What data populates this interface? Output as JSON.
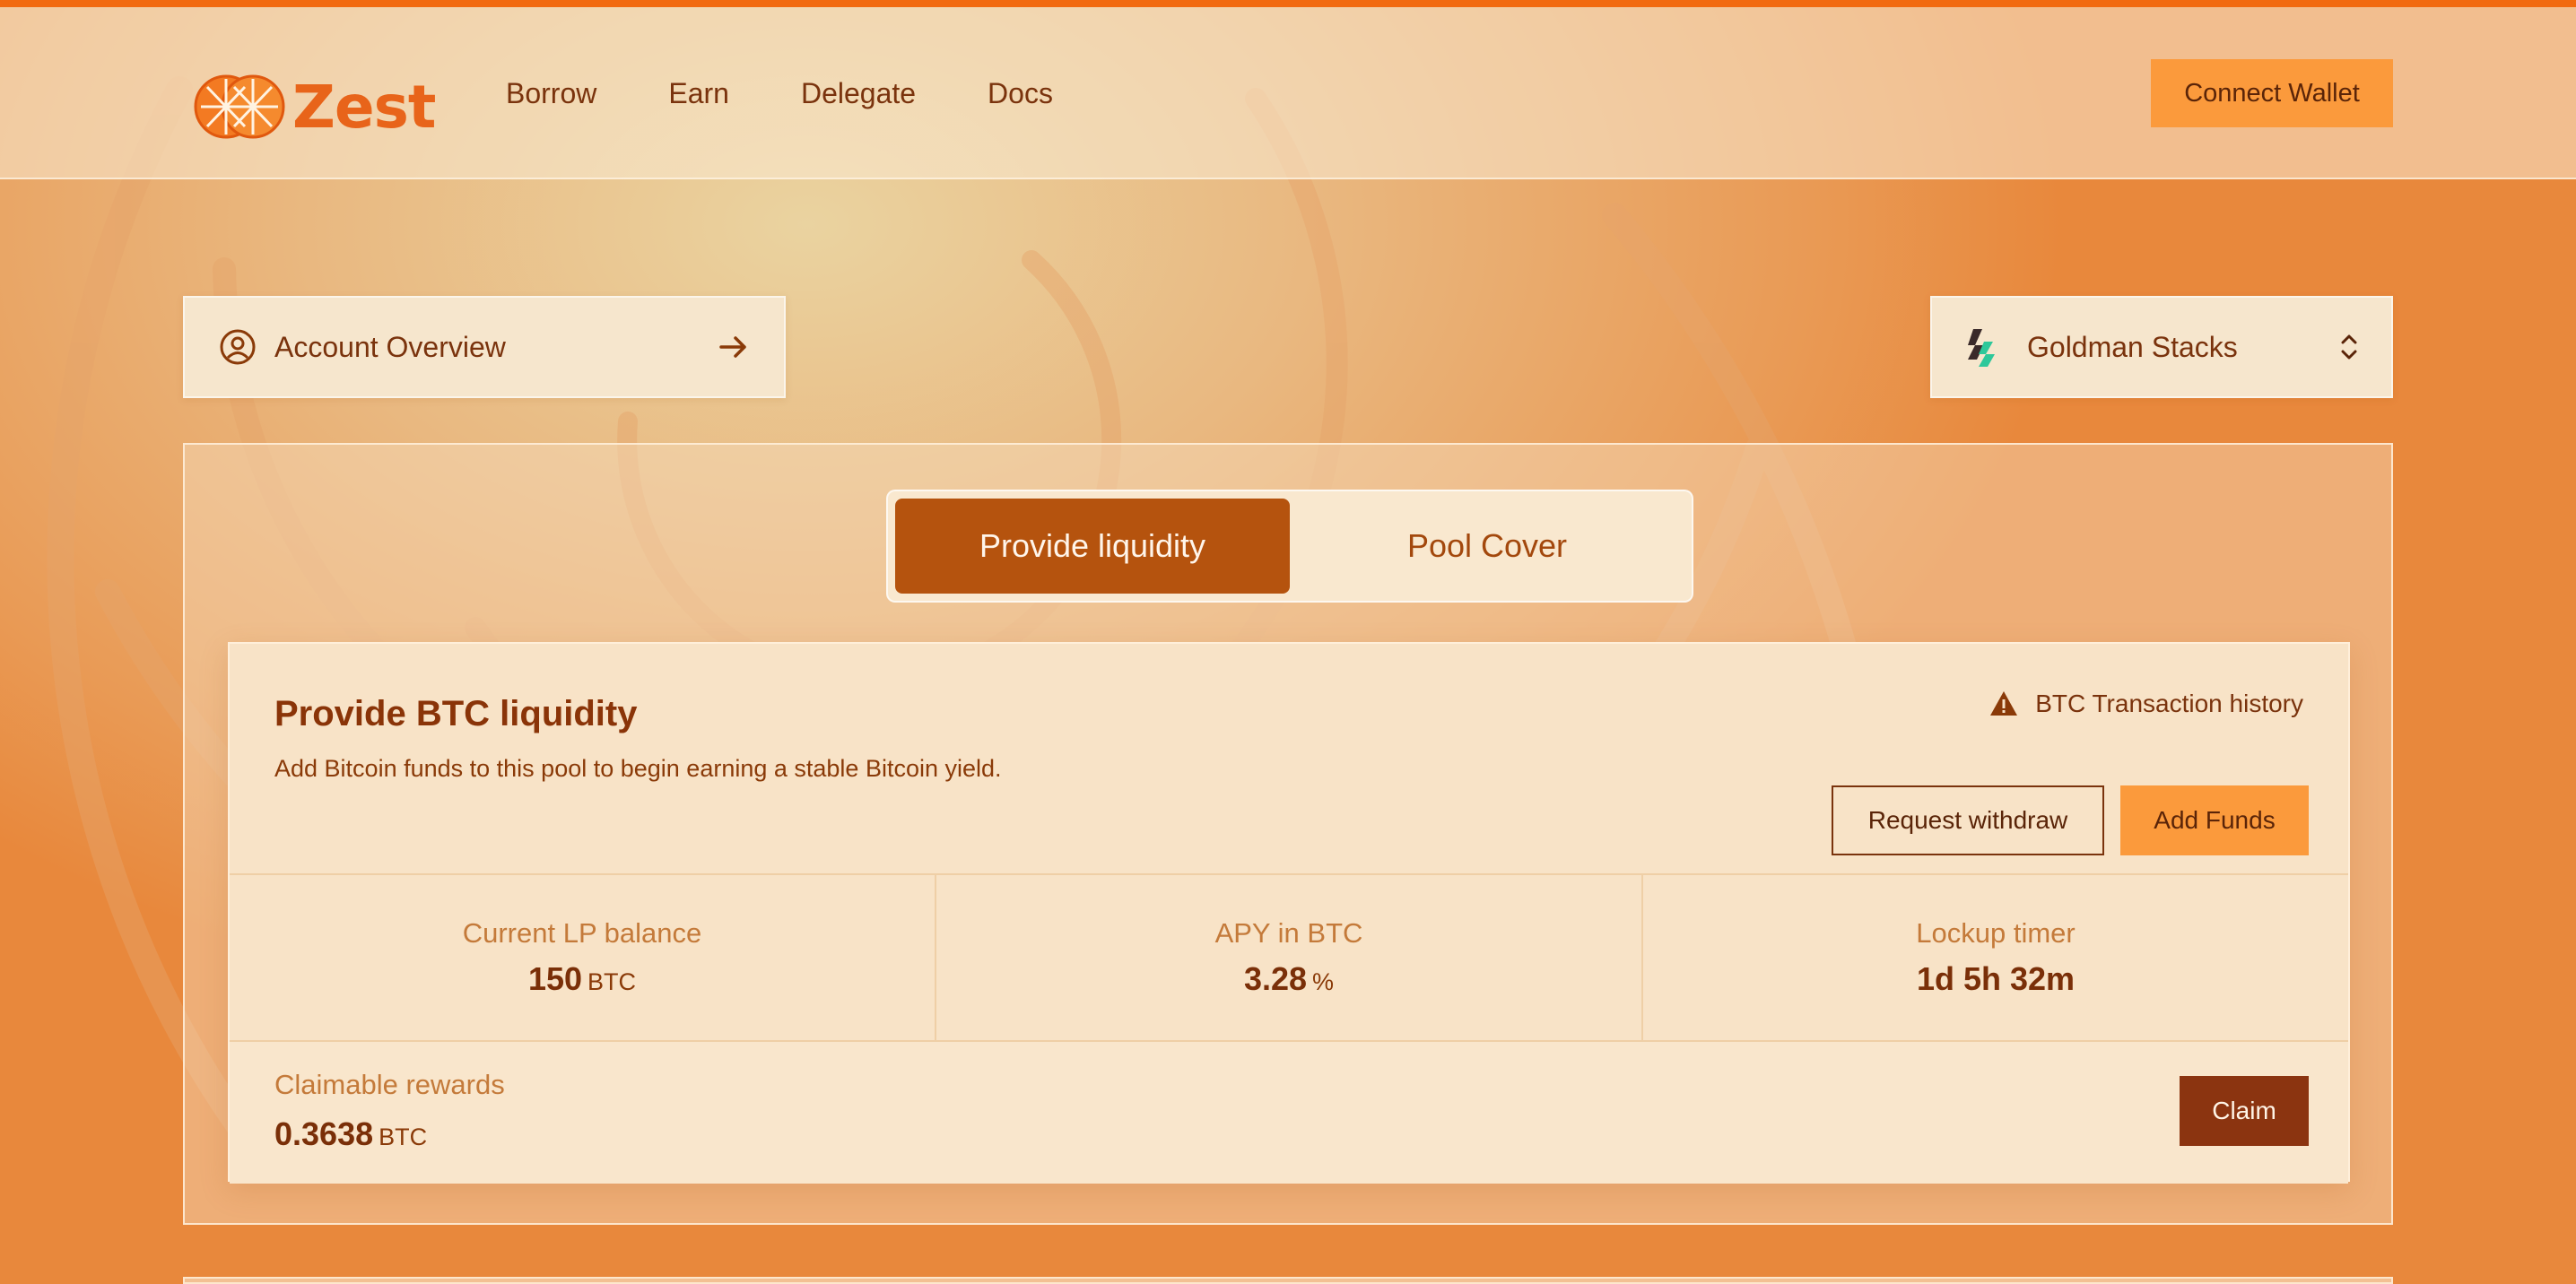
{
  "brand": {
    "name": "Zest",
    "accent": "#e8641a"
  },
  "nav": {
    "items": [
      "Borrow",
      "Earn",
      "Delegate",
      "Docs"
    ]
  },
  "header": {
    "connect_label": "Connect Wallet"
  },
  "account": {
    "label": "Account Overview",
    "icon": "user-circle-icon",
    "arrow_icon": "arrow-right-icon"
  },
  "pool": {
    "selected": "Goldman Stacks",
    "icon": "goldman-stacks-icon",
    "chevron_icon": "chevron-up-down-icon"
  },
  "tabs": [
    {
      "label": "Provide liquidity",
      "active": true
    },
    {
      "label": "Pool Cover",
      "active": false
    }
  ],
  "section": {
    "title": "Provide BTC liquidity",
    "subtitle": "Add Bitcoin funds to this pool to begin earning a stable Bitcoin yield.",
    "history_label": "BTC Transaction history",
    "history_icon": "warning-icon",
    "withdraw_label": "Request withdraw",
    "add_label": "Add Funds"
  },
  "stats": [
    {
      "label": "Current LP balance",
      "value": "150",
      "unit": "BTC"
    },
    {
      "label": "APY in BTC",
      "value": "3.28",
      "unit": "%"
    },
    {
      "label": "Lockup timer",
      "value": "1d 5h 32m",
      "unit": ""
    }
  ],
  "rewards": {
    "label": "Claimable rewards",
    "value": "0.3638",
    "unit": "BTC",
    "claim_label": "Claim"
  },
  "colors": {
    "primary": "#b5530e",
    "button": "#fb9a3c",
    "claim": "#8b3410",
    "topbar": "#f26a10"
  }
}
